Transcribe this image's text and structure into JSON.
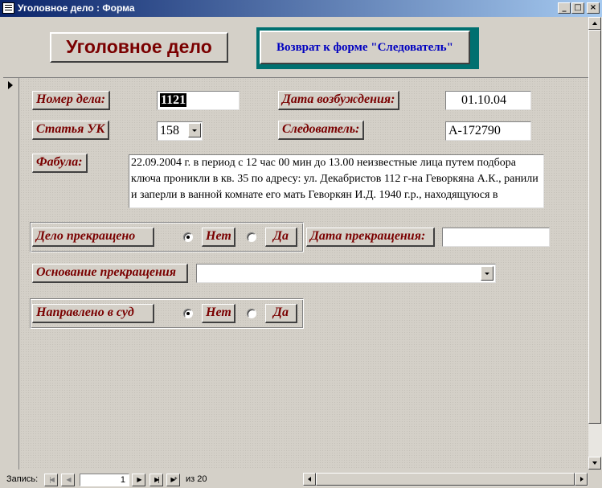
{
  "window": {
    "title": "Уголовное дело : Форма",
    "minimize": "_",
    "restore": "□",
    "close": "×"
  },
  "header": {
    "title": "Уголовное дело",
    "back_button": "Возврат к форме \"Следователь\""
  },
  "case": {
    "number_label": "Номер дела:",
    "number_value": "1121",
    "date_label": "Дата возбуждения:",
    "date_value": "01.10.04",
    "article_label": "Статья УК",
    "article_value": "158",
    "investigator_label": "Следователь:",
    "investigator_value": "А-172790",
    "fabula_label": "Фабула:",
    "fabula_value": "22.09.2004 г. в период с 12 час 00 мин до 13.00 неизвестные лица путем подбора ключа проникли в кв. 35 по адресу: ул. Декабристов 112 г-на Геворкяна А.К., ранили и заперли в ванной комнате его мать Геворкян И.Д. 1940 г.р., находящуюся в квартире, и похитили ценные вещи: ювелирные"
  },
  "terminated": {
    "label": "Дело прекращено",
    "option_no": "Нет",
    "option_yes": "Да",
    "selected": "Нет",
    "date_label": "Дата прекращения:",
    "date_value": ""
  },
  "basis": {
    "label": "Основание прекращения",
    "value": ""
  },
  "court": {
    "label": "Направлено в суд",
    "option_no": "Нет",
    "option_yes": "Да",
    "selected": "Нет"
  },
  "navigation": {
    "record_label": "Запись:",
    "first": "|◀",
    "prev": "◀",
    "current": "1",
    "next": "▶",
    "last": "▶|",
    "new": "▶*",
    "total": "из  20"
  },
  "colors": {
    "label_text": "#7a0000",
    "back_button_text": "#0000c0",
    "back_button_shadow": "#007070",
    "face": "#d4d0c8"
  }
}
